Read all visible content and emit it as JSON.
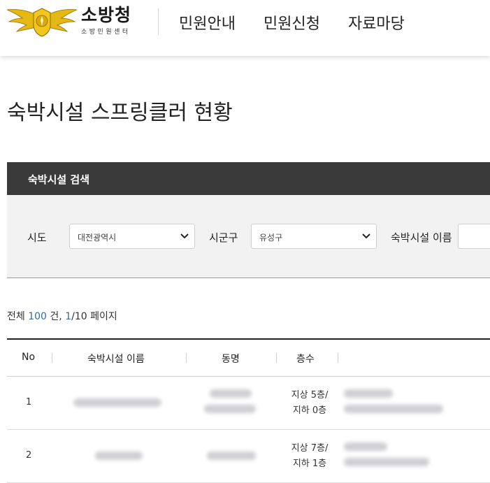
{
  "header": {
    "brand_main": "소방청",
    "brand_sub": "소방민원센터",
    "nav": [
      "민원안내",
      "민원신청",
      "자료마당"
    ]
  },
  "page": {
    "title": "숙박시설 스프링클러 현황"
  },
  "search": {
    "title": "숙박시설 검색",
    "sido_label": "시도",
    "sido_value": "대전광역시",
    "sigungu_label": "시군구",
    "sigungu_value": "유성구",
    "name_label": "숙박시설 이름"
  },
  "summary": {
    "prefix": "전체",
    "total": "100",
    "unit": " 건,",
    "page_current": "1",
    "page_total": "/10 페이지"
  },
  "table": {
    "headers": [
      "No",
      "숙박시설 이름",
      "동명",
      "층수"
    ],
    "rows": [
      {
        "no": "1",
        "floor_above": "지상 5층/",
        "floor_below": "지하 0층"
      },
      {
        "no": "2",
        "floor_above": "지상 7층/",
        "floor_below": "지하 1층"
      }
    ]
  },
  "colors": {
    "accent_link": "#2f6ca8",
    "search_header_bg": "#3a3a3a",
    "search_body_bg": "#f2f2f2",
    "logo_gold": "#e6b814"
  }
}
